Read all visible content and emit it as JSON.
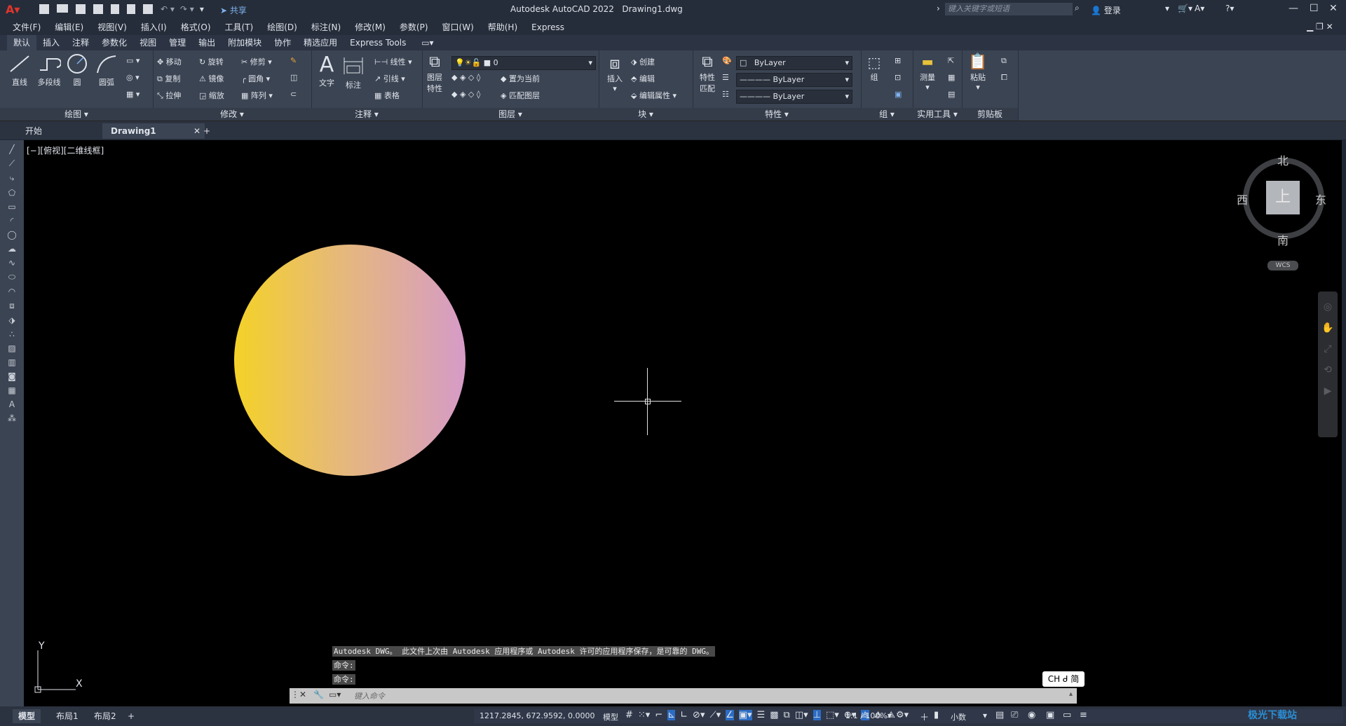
{
  "titlebar": {
    "app_title": "Autodesk AutoCAD 2022",
    "doc_title": "Drawing1.dwg",
    "share": "共享",
    "search_placeholder": "键入关键字或短语",
    "login": "登录"
  },
  "menu": [
    "文件(F)",
    "编辑(E)",
    "视图(V)",
    "插入(I)",
    "格式(O)",
    "工具(T)",
    "绘图(D)",
    "标注(N)",
    "修改(M)",
    "参数(P)",
    "窗口(W)",
    "帮助(H)",
    "Express"
  ],
  "ribbon_tabs": [
    "默认",
    "插入",
    "注释",
    "参数化",
    "视图",
    "管理",
    "输出",
    "附加模块",
    "协作",
    "精选应用",
    "Express Tools"
  ],
  "ribbon": {
    "draw": {
      "title": "绘图",
      "line": "直线",
      "polyline": "多段线",
      "circle": "圆",
      "arc": "圆弧"
    },
    "modify": {
      "title": "修改",
      "move": "移动",
      "rotate": "旋转",
      "trim": "修剪",
      "copy": "复制",
      "mirror": "镜像",
      "fillet": "圆角",
      "stretch": "拉伸",
      "scale": "缩放",
      "array": "阵列"
    },
    "annotation": {
      "title": "注释",
      "text": "文字",
      "dimension": "标注",
      "linear": "线性",
      "leader": "引线",
      "table": "表格"
    },
    "layers": {
      "title": "图层",
      "props_line1": "图层",
      "props_line2": "特性",
      "layer_value": "0",
      "set_current": "置为当前",
      "match_layer": "匹配图层"
    },
    "block": {
      "title": "块",
      "insert": "插入",
      "create": "创建",
      "edit": "编辑",
      "edit_attr": "编辑属性"
    },
    "properties": {
      "title": "特性",
      "match_line1": "特性",
      "match_line2": "匹配",
      "color": "ByLayer",
      "linetype": "ByLayer",
      "lineweight": "ByLayer"
    },
    "groups": {
      "title": "组",
      "group": "组"
    },
    "utilities": {
      "title": "实用工具",
      "measure": "测量"
    },
    "clipboard": {
      "title": "剪贴板",
      "paste": "粘贴"
    }
  },
  "doc_tabs": {
    "start": "开始",
    "drawing": "Drawing1"
  },
  "viewport": {
    "label": "[−][俯视][二维线框]"
  },
  "viewcube": {
    "north": "北",
    "south": "南",
    "east": "东",
    "west": "西",
    "top": "上",
    "wcs": "WCS"
  },
  "ucs": {
    "x": "X",
    "y": "Y"
  },
  "command": {
    "history": [
      "Autodesk DWG。 此文件上次由 Autodesk 应用程序或 Autodesk 许可的应用程序保存，是可靠的 DWG。",
      "命令:",
      "命令:"
    ],
    "placeholder": "键入命令"
  },
  "ime": "CH ᑯ 简",
  "layout_tabs": [
    "模型",
    "布局1",
    "布局2"
  ],
  "status": {
    "coords": "1217.2845, 672.9592, 0.0000",
    "model": "模型",
    "scale": "1:1 / 100%",
    "units": "小数"
  },
  "watermark": "极光下载站",
  "colors": {
    "accent": "#2b6cc4",
    "canvas": "#000000",
    "ribbon": "#3b4453"
  }
}
